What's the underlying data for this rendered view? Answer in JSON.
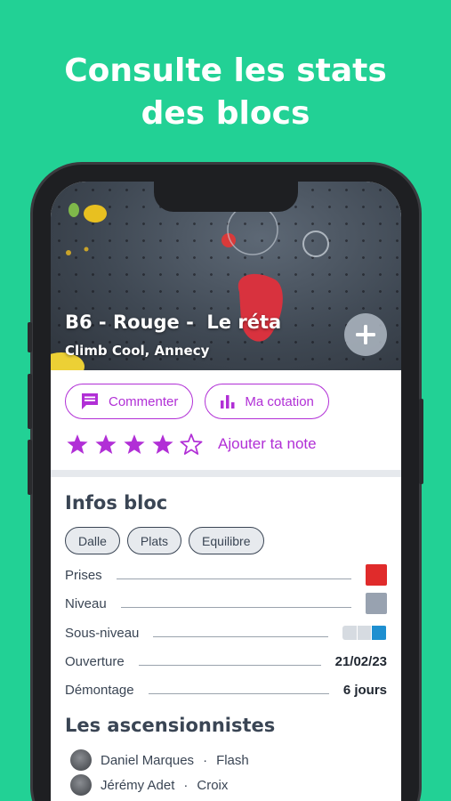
{
  "headline": {
    "line1": "Consulte les stats",
    "line2": "des blocs"
  },
  "bloc": {
    "title": "B6 - Rouge -  Le réta",
    "location": "Climb Cool, Annecy"
  },
  "actions": {
    "comment_label": "Commenter",
    "grade_label": "Ma cotation"
  },
  "rating": {
    "value": 4,
    "max": 5,
    "add_label": "Ajouter ta note"
  },
  "infos": {
    "title": "Infos bloc",
    "tags": [
      "Dalle",
      "Plats",
      "Equilibre"
    ],
    "rows": {
      "prises": {
        "label": "Prises",
        "color": "#e02b2b"
      },
      "niveau": {
        "label": "Niveau",
        "color": "#98a2b0"
      },
      "sous_niveau": {
        "label": "Sous-niveau",
        "level": 3,
        "max": 3,
        "active_color": "#1e8fd0",
        "inactive_color": "#d6dbe1"
      },
      "ouverture": {
        "label": "Ouverture",
        "value": "21/02/23"
      },
      "demontage": {
        "label": "Démontage",
        "value": "6 jours"
      }
    }
  },
  "climbers": {
    "title": "Les ascensionnistes",
    "items": [
      {
        "name": "Daniel Marques",
        "style": "Flash"
      },
      {
        "name": "Jérémy Adet",
        "style": "Croix"
      }
    ]
  },
  "colors": {
    "background": "#22d195",
    "accent": "#b12fd6",
    "text": "#3a4554"
  },
  "icons": {
    "comment": "comment-icon",
    "chart": "bar-chart-icon",
    "plus": "plus-icon",
    "star": "star-icon"
  }
}
